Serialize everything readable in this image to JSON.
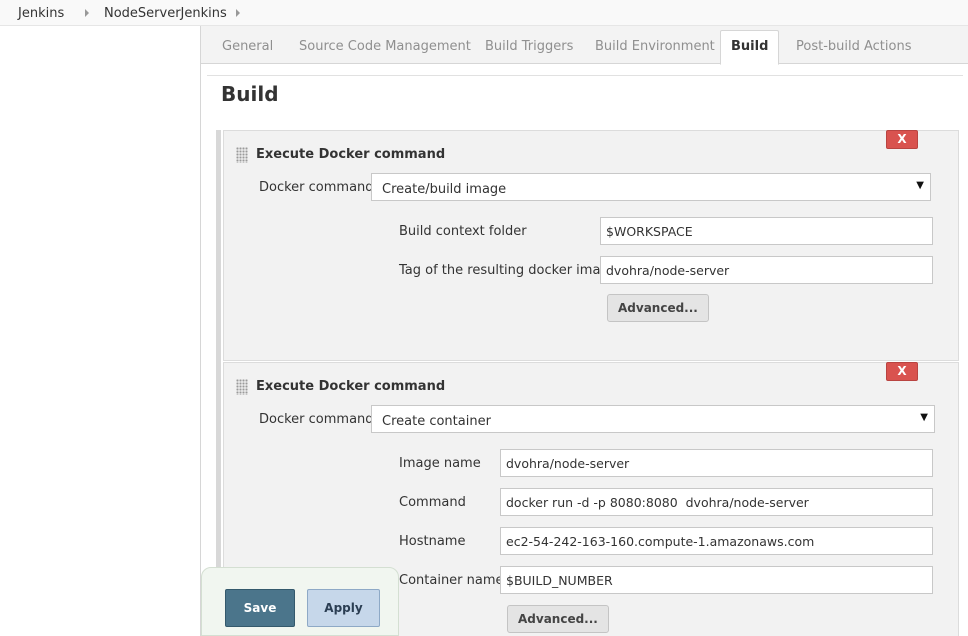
{
  "breadcrumb": {
    "items": [
      "Jenkins",
      "NodeServerJenkins"
    ]
  },
  "tabs": [
    "General",
    "Source Code Management",
    "Build Triggers",
    "Build Environment",
    "Build",
    "Post-build Actions"
  ],
  "active_tab": "Build",
  "section_title": "Build",
  "steps": [
    {
      "title": "Execute Docker command",
      "delete_label": "X",
      "command_label": "Docker command",
      "command_value": "Create/build image",
      "fields": [
        {
          "label": "Build context folder",
          "value": "$WORKSPACE"
        },
        {
          "label": "Tag of the resulting docker image",
          "value": "dvohra/node-server"
        }
      ],
      "advanced_label": "Advanced..."
    },
    {
      "title": "Execute Docker command",
      "delete_label": "X",
      "command_label": "Docker command",
      "command_value": "Create container",
      "fields": [
        {
          "label": "Image name",
          "value": "dvohra/node-server"
        },
        {
          "label": "Command",
          "value": "docker run -d -p 8080:8080  dvohra/node-server"
        },
        {
          "label": "Hostname",
          "value": "ec2-54-242-163-160.compute-1.amazonaws.com"
        },
        {
          "label": "Container name",
          "value": "$BUILD_NUMBER"
        }
      ],
      "advanced_label": "Advanced..."
    }
  ],
  "actions": {
    "save_label": "Save",
    "apply_label": "Apply"
  },
  "colors": {
    "delete": "#d9534f",
    "save": "#4b758b",
    "apply": "#c6d7ea"
  }
}
